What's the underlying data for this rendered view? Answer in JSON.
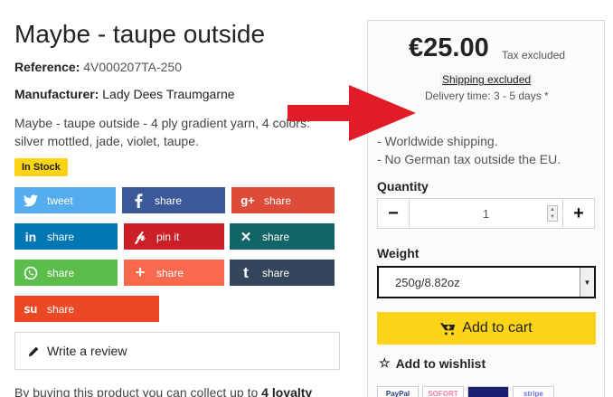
{
  "product": {
    "title": "Maybe - taupe outside",
    "reference_label": "Reference:",
    "reference_value": "4V000207TA-250",
    "manufacturer_label": "Manufacturer:",
    "manufacturer_value": "Lady Dees Traumgarne",
    "description": "Maybe - taupe outside - 4 ply gradient yarn, 4 colors: silver mottled, jade, violet, taupe.",
    "stock_badge": "In Stock"
  },
  "share_buttons": [
    {
      "label": "tweet",
      "icon": "twitter-icon",
      "color": "#55acee"
    },
    {
      "label": "share",
      "icon": "facebook-icon",
      "color": "#3b5998"
    },
    {
      "label": "share",
      "icon": "google-plus-icon",
      "color": "#dd4b39"
    },
    {
      "label": "share",
      "icon": "linkedin-icon",
      "color": "#0077b5"
    },
    {
      "label": "pin it",
      "icon": "pinterest-icon",
      "color": "#cb2027"
    },
    {
      "label": "share",
      "icon": "xing-icon",
      "color": "#126567"
    },
    {
      "label": "share",
      "icon": "whatsapp-icon",
      "color": "#5cbe4a"
    },
    {
      "label": "share",
      "icon": "addthis-icon",
      "color": "#f8694d"
    },
    {
      "label": "share",
      "icon": "tumblr-icon",
      "color": "#35465c"
    },
    {
      "label": "share",
      "icon": "stumbleupon-icon",
      "color": "#eb4924"
    }
  ],
  "review": {
    "label": "Write a review",
    "icon": "pencil-icon"
  },
  "loyalty": {
    "prefix": "By buying this product you can collect up to",
    "points": "4 loyalty"
  },
  "buy_box": {
    "price": "€25.00",
    "tax_note": "Tax excluded",
    "shipping_link": "Shipping excluded",
    "delivery": "Delivery time: 3 - 5 days *",
    "features": [
      "- Worldwide shipping.",
      "- No German tax outside the EU."
    ],
    "quantity_label": "Quantity",
    "quantity_value": "1",
    "minus": "−",
    "plus": "+",
    "weight_label": "Weight",
    "weight_selected": "250g/8.82oz",
    "add_to_cart": "Add to cart",
    "wishlist": "Add to wishlist",
    "payment_icons": [
      "PayPal",
      "SOFORT",
      "",
      "stripe"
    ]
  },
  "colors": {
    "accent_yellow": "#fbd317",
    "annotation_arrow": "#e21c26"
  }
}
